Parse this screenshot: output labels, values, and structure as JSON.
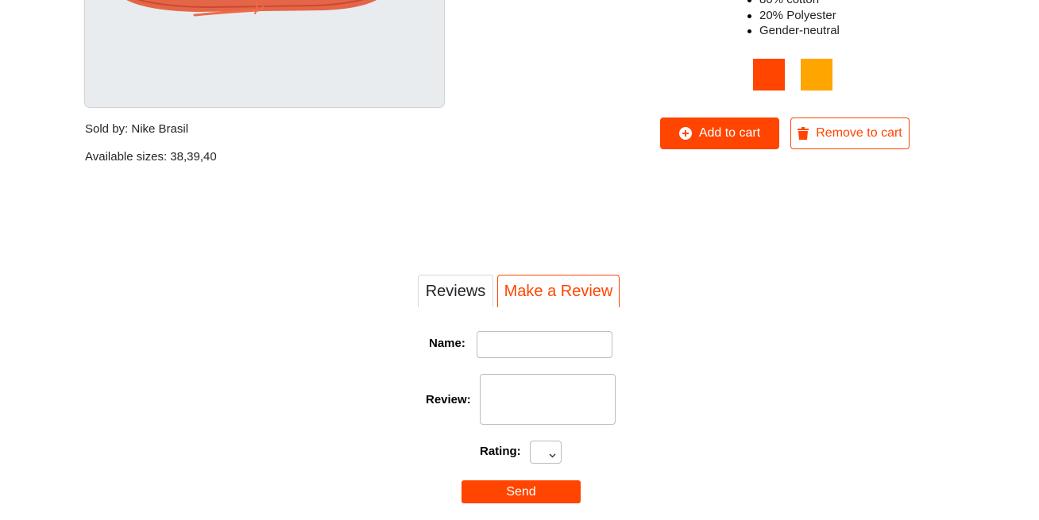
{
  "product": {
    "image_icon": "sneaker-image",
    "sold_by": "Sold by: Nike Brasil",
    "available_sizes": "Available sizes: 38,39,40",
    "description": [
      "80% cotton",
      "20% Polyester",
      "Gender-neutral"
    ],
    "colors": [
      "#ff4500",
      "#ffa500"
    ]
  },
  "actions": {
    "add_to_cart": "Add to cart",
    "add_icon": "plus-circle-icon",
    "remove_from_cart": "Remove to cart",
    "remove_icon": "trash-icon"
  },
  "tabs": [
    {
      "label": "Reviews",
      "active": false
    },
    {
      "label": "Make a Review",
      "active": true
    }
  ],
  "review_form": {
    "name_label": "Name:",
    "name_value": "",
    "review_label": "Review:",
    "review_value": "",
    "rating_label": "Rating:",
    "rating_value": "",
    "send_label": "Send"
  },
  "theme": {
    "accent": "#ff4500",
    "secondary": "#ffa500"
  }
}
